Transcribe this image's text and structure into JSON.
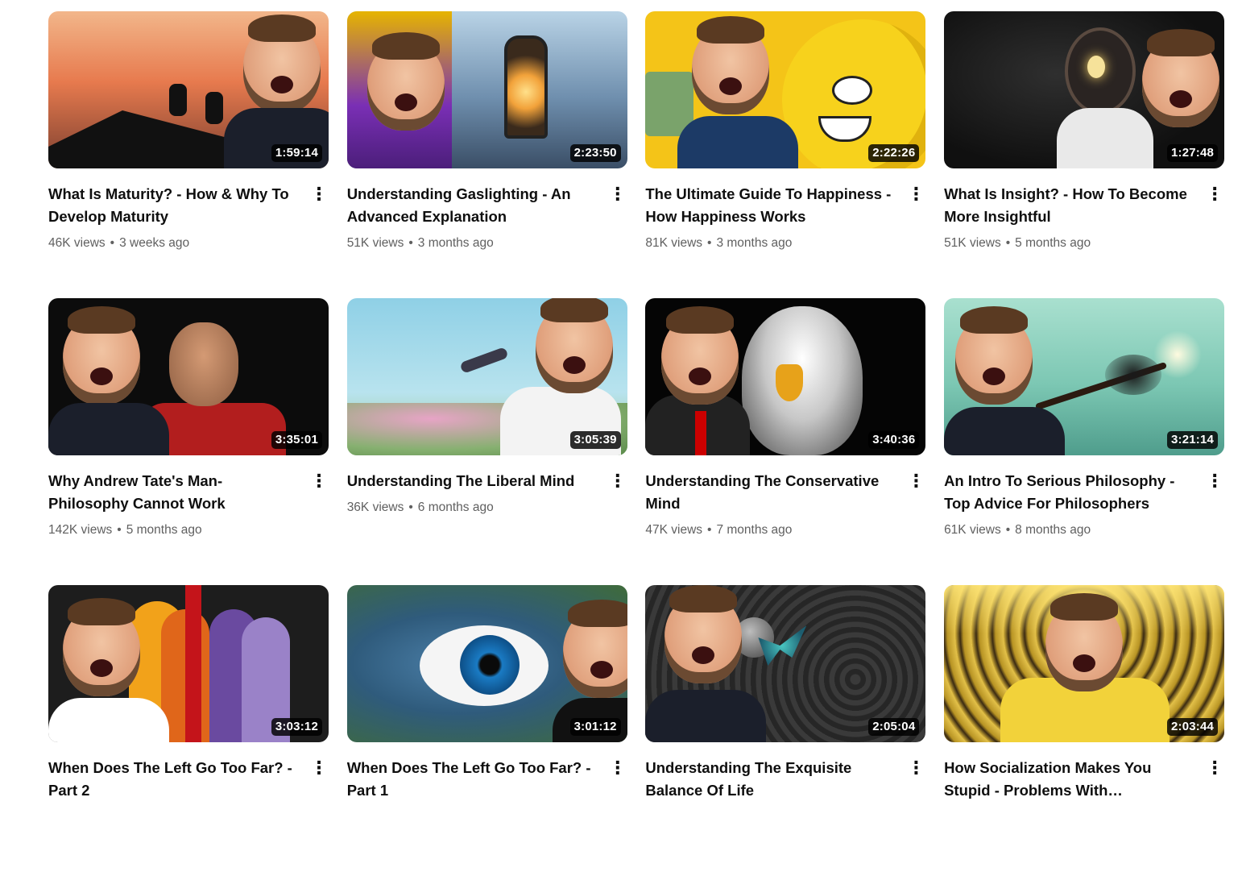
{
  "videos": [
    {
      "title": "What Is Maturity? - How & Why To Develop Maturity",
      "views": "46K views",
      "age": "3 weeks ago",
      "duration": "1:59:14",
      "menu_icon": "more-vert-icon"
    },
    {
      "title": "Understanding Gaslighting - An Advanced Explanation",
      "views": "51K views",
      "age": "3 months ago",
      "duration": "2:23:50",
      "menu_icon": "more-vert-icon"
    },
    {
      "title": "The Ultimate Guide To Happiness - How Happiness Works",
      "views": "81K views",
      "age": "3 months ago",
      "duration": "2:22:26",
      "menu_icon": "more-vert-icon"
    },
    {
      "title": "What Is Insight? - How To Become More Insightful",
      "views": "51K views",
      "age": "5 months ago",
      "duration": "1:27:48",
      "menu_icon": "more-vert-icon"
    },
    {
      "title": "Why Andrew Tate's Man-Philosophy Cannot Work",
      "views": "142K views",
      "age": "5 months ago",
      "duration": "3:35:01",
      "menu_icon": "more-vert-icon"
    },
    {
      "title": "Understanding The Liberal Mind",
      "views": "36K views",
      "age": "6 months ago",
      "duration": "3:05:39",
      "menu_icon": "more-vert-icon"
    },
    {
      "title": "Understanding The Conservative Mind",
      "views": "47K views",
      "age": "7 months ago",
      "duration": "3:40:36",
      "menu_icon": "more-vert-icon"
    },
    {
      "title": "An Intro To Serious Philosophy - Top Advice For Philosophers",
      "views": "61K views",
      "age": "8 months ago",
      "duration": "3:21:14",
      "menu_icon": "more-vert-icon"
    },
    {
      "title": "When Does The Left Go Too Far? - Part 2",
      "views": "",
      "age": "",
      "duration": "3:03:12",
      "menu_icon": "more-vert-icon"
    },
    {
      "title": "When Does The Left Go Too Far? - Part 1",
      "views": "",
      "age": "",
      "duration": "3:01:12",
      "menu_icon": "more-vert-icon"
    },
    {
      "title": "Understanding The Exquisite Balance Of Life",
      "views": "",
      "age": "",
      "duration": "2:05:04",
      "menu_icon": "more-vert-icon"
    },
    {
      "title": "How Socialization Makes You Stupid - Problems With Conformity...",
      "views": "",
      "age": "",
      "duration": "2:03:44",
      "menu_icon": "more-vert-icon"
    }
  ],
  "separator": "•",
  "kebab_glyph": "⋮"
}
